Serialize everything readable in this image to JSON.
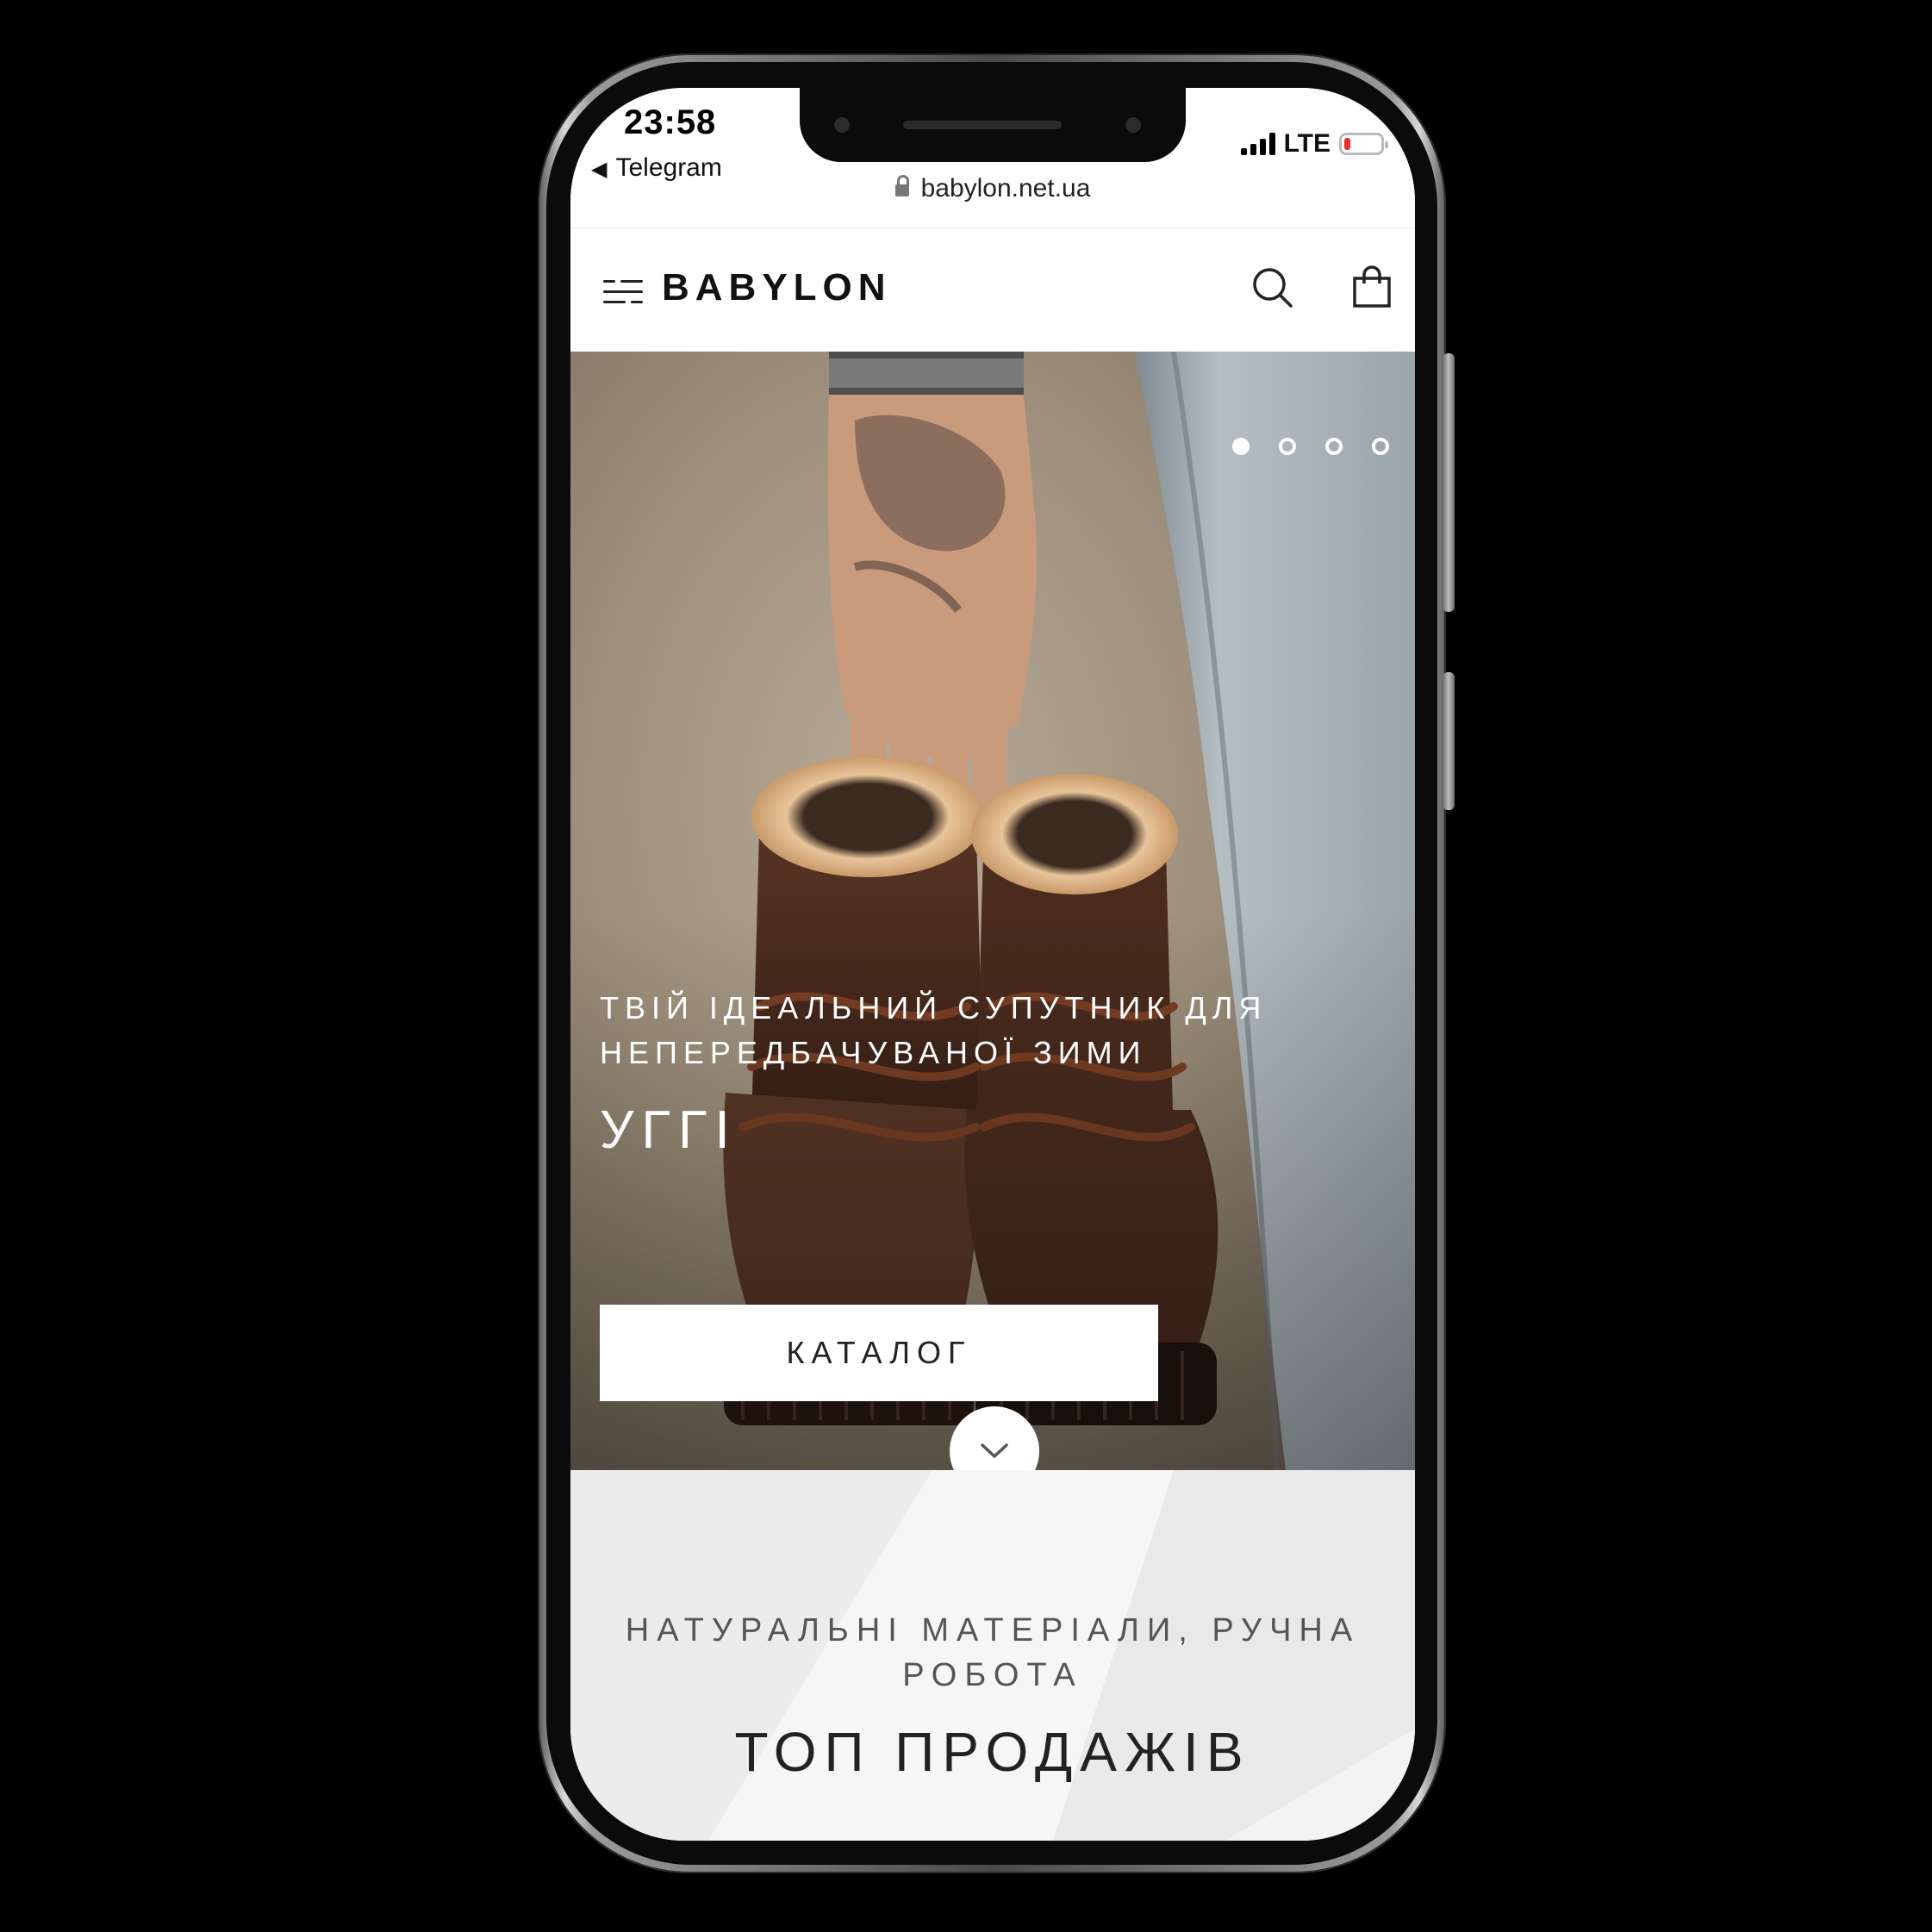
{
  "status_bar": {
    "time": "23:58",
    "back_app": "Telegram",
    "network": "LTE",
    "url": "babylon.net.ua"
  },
  "header": {
    "logo": "BABYLON"
  },
  "hero": {
    "slide_count": 4,
    "active_slide": 1,
    "subtitle_line1": "ТВІЙ ІДЕАЛЬНИЙ СУПУТНИК ДЛЯ",
    "subtitle_line2": "НЕПЕРЕДБАЧУВАНОЇ ЗИМИ",
    "title": "УГГІ",
    "button": "КАТАЛОГ"
  },
  "section": {
    "subtitle_line1": "НАТУРАЛЬНІ МАТЕРІАЛИ, РУЧНА",
    "subtitle_line2": "РОБОТА",
    "title": "ТОП ПРОДАЖІВ"
  },
  "icons": {
    "menu": "menu-icon",
    "search": "search-icon",
    "bag": "shopping-bag-icon",
    "scroll": "chevron-down-icon"
  },
  "colors": {
    "battery_low": "#e53030",
    "hero_text": "#ffffff",
    "section_bg": "#f2f2f2"
  }
}
